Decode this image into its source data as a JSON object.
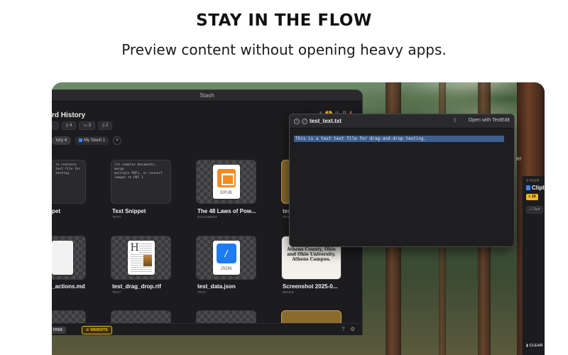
{
  "marketing": {
    "headline": "STAY IN THE FLOW",
    "subline": "Preview content without opening heavy apps."
  },
  "stash_window": {
    "title": "Stash",
    "heading": "rd History",
    "toolbar_count": "1",
    "filter_chips": [
      "4",
      "3",
      "2"
    ],
    "tabs": [
      {
        "label": "tory",
        "count": "4"
      },
      {
        "label": "My Stash",
        "count": "1"
      }
    ],
    "add_tab_label": "+",
    "items": [
      {
        "preview": "le contains test file for\ntesting.",
        "title": "pet",
        "type": ""
      },
      {
        "preview": "lit complex documents, merge\nmultiple PDFs, or convert\nimages to PDF 1",
        "title": "Text Snippet",
        "type": "TEXT"
      },
      {
        "preview_label": "EPUB",
        "title": "The 48 Laws of Pow...",
        "type": "DOCUMENT"
      },
      {
        "title": "tes",
        "type": "TEX"
      },
      {
        "title": "_actions.md",
        "type": ""
      },
      {
        "preview_label": "H",
        "title": "test_drag_drop.rtf",
        "type": "TEXT"
      },
      {
        "preview_label": "JSON",
        "title": "test_data.json",
        "type": "TEXT"
      },
      {
        "preview": "Mobile App for Athens County, Ohio and Ohio University, Athens Campus.",
        "title": "Screenshot 2025-0...",
        "type": "IMAGE"
      }
    ],
    "footer": {
      "free_label": "FREE",
      "website_label": "WEBSITE",
      "help_icon": "?",
      "settings_icon": "⚙"
    }
  },
  "preview_window": {
    "title": "test_text.txt",
    "open_with_label": "Open with TextEdit",
    "content": "This is a test text file for drag-and-drop testing."
  },
  "side_panel": {
    "section_label": "STASH",
    "title": "Clipb",
    "count": "16",
    "chip_label": "Clipb",
    "clear_label": "CLEAR",
    "partial_text": "er"
  },
  "colors": {
    "accent": "#f5b920",
    "blue": "#3a86ff",
    "window_bg": "#1c1c1e"
  }
}
